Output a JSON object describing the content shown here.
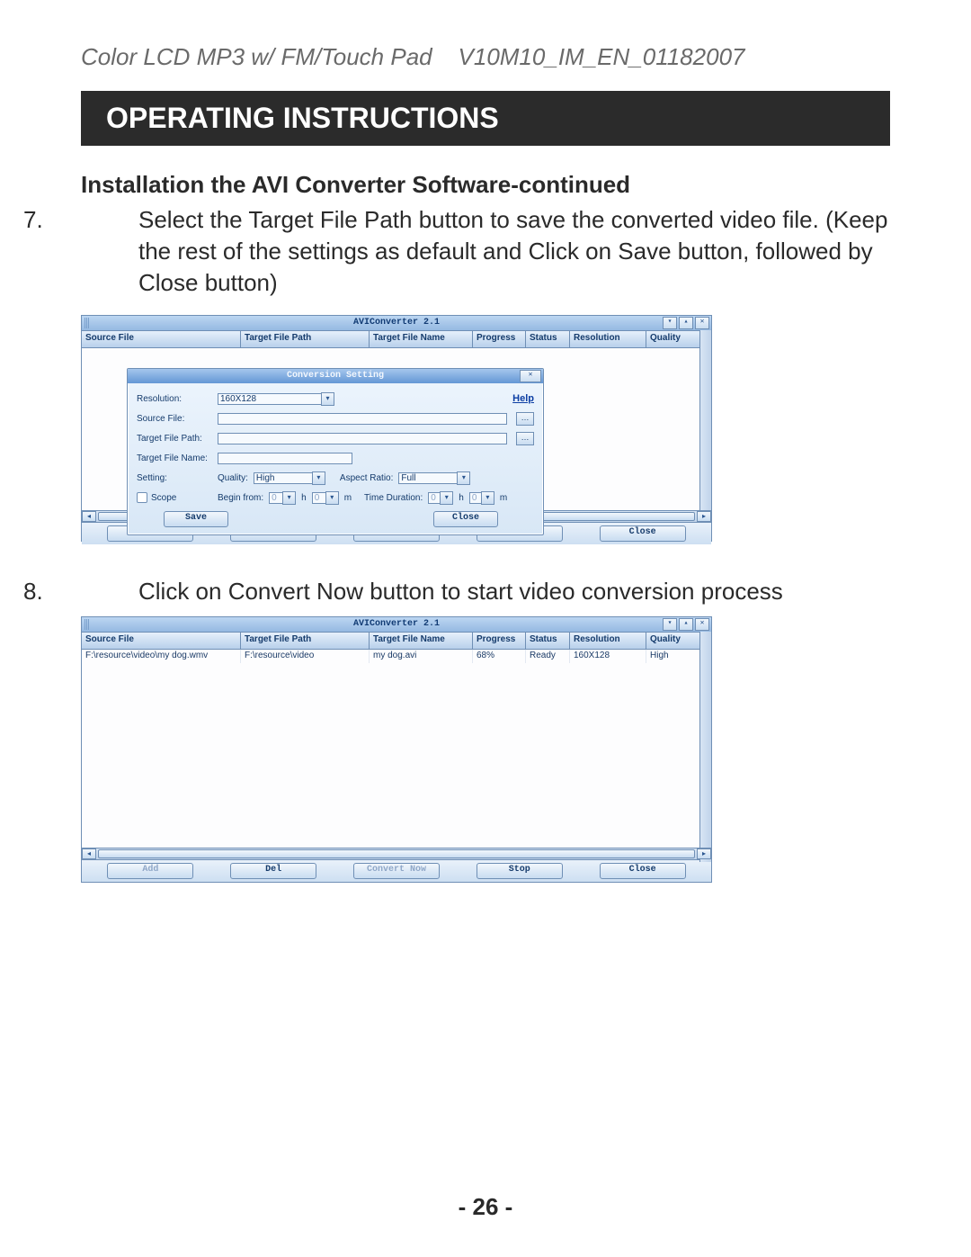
{
  "doc_header": "Color LCD MP3 w/ FM/Touch Pad    V10M10_IM_EN_01182007",
  "section_title": "OPERATING INSTRUCTIONS",
  "subheading": "Installation the AVI Converter Software-continued",
  "step7": {
    "num": "7.",
    "text": "Select the Target File Path button to save the converted video file. (Keep the rest of the settings as default and Click on Save button, followed by Close button)"
  },
  "step8": {
    "num": "8.",
    "text": "Click on Convert Now button to start video conversion process"
  },
  "page_number": "- 26 -",
  "app": {
    "title": "AVIConverter 2.1",
    "title2": "AVIConverter 2.1",
    "columns": {
      "source": "Source File",
      "target_path": "Target File Path",
      "target_name": "Target File Name",
      "progress": "Progress",
      "status": "Status",
      "resolution": "Resolution",
      "quality": "Quality"
    },
    "row": {
      "source": "F:\\resource\\video\\my dog.wmv",
      "target_path": "F:\\resource\\video",
      "target_name": "my dog.avi",
      "progress": "68%",
      "status": "Ready",
      "resolution": "160X128",
      "quality": "High"
    },
    "buttons": {
      "add": "Add",
      "del": "Del",
      "convert": "Convert Now",
      "stop": "Stop",
      "close": "Close"
    },
    "win": {
      "min": "▾",
      "max": "▴",
      "close": "✕"
    }
  },
  "dialog": {
    "title": "Conversion Setting",
    "close_glyph": "✕",
    "labels": {
      "resolution": "Resolution:",
      "source_file": "Source File:",
      "target_path": "Target File Path:",
      "target_name": "Target File Name:",
      "setting": "Setting:",
      "quality": "Quality:",
      "aspect": "Aspect Ratio:",
      "scope": "Scope",
      "begin_from": "Begin from:",
      "time_duration": "Time Duration:"
    },
    "values": {
      "resolution": "160X128",
      "source_file": "",
      "target_path": "",
      "target_name": "",
      "quality": "High",
      "aspect": "Full",
      "begin_h": "0",
      "begin_m": "0",
      "dur_h": "0",
      "dur_m": "0"
    },
    "units": {
      "h": "h",
      "m": "m"
    },
    "help": "Help",
    "caret": "▾",
    "browse": "…",
    "buttons": {
      "save": "Save",
      "close": "Close"
    }
  }
}
